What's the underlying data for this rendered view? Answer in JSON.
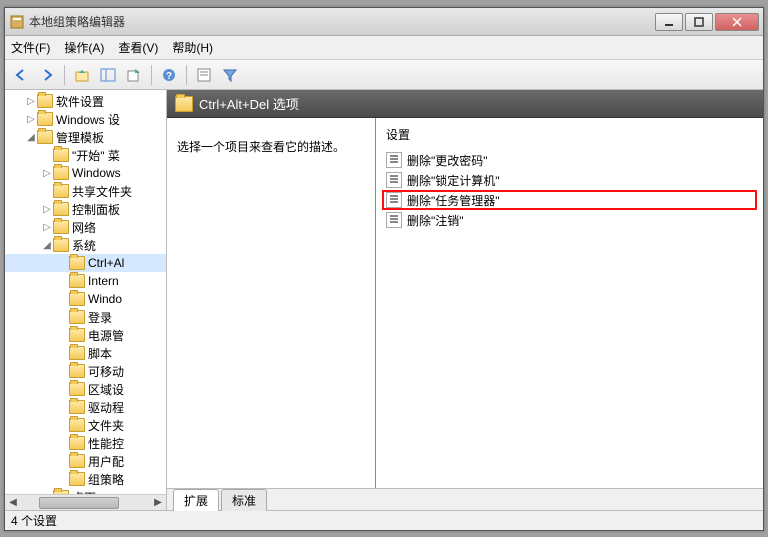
{
  "window": {
    "title": "本地组策略编辑器"
  },
  "menu": {
    "file": "文件(F)",
    "action": "操作(A)",
    "view": "查看(V)",
    "help": "帮助(H)"
  },
  "tree": {
    "items": [
      {
        "label": "软件设置",
        "depth": 1,
        "expander": "▷"
      },
      {
        "label": "Windows 设",
        "depth": 1,
        "expander": "▷"
      },
      {
        "label": "管理模板",
        "depth": 1,
        "expander": "◢"
      },
      {
        "label": "\"开始\" 菜",
        "depth": 2,
        "expander": ""
      },
      {
        "label": "Windows",
        "depth": 2,
        "expander": "▷"
      },
      {
        "label": "共享文件夹",
        "depth": 2,
        "expander": ""
      },
      {
        "label": "控制面板",
        "depth": 2,
        "expander": "▷"
      },
      {
        "label": "网络",
        "depth": 2,
        "expander": "▷"
      },
      {
        "label": "系统",
        "depth": 2,
        "expander": "◢"
      },
      {
        "label": "Ctrl+Al",
        "depth": 3,
        "expander": "",
        "selected": true
      },
      {
        "label": "Intern",
        "depth": 3,
        "expander": ""
      },
      {
        "label": "Windo",
        "depth": 3,
        "expander": ""
      },
      {
        "label": "登录",
        "depth": 3,
        "expander": ""
      },
      {
        "label": "电源管",
        "depth": 3,
        "expander": ""
      },
      {
        "label": "脚本",
        "depth": 3,
        "expander": ""
      },
      {
        "label": "可移动",
        "depth": 3,
        "expander": ""
      },
      {
        "label": "区域设",
        "depth": 3,
        "expander": ""
      },
      {
        "label": "驱动程",
        "depth": 3,
        "expander": ""
      },
      {
        "label": "文件夹",
        "depth": 3,
        "expander": ""
      },
      {
        "label": "性能控",
        "depth": 3,
        "expander": ""
      },
      {
        "label": "用户配",
        "depth": 3,
        "expander": ""
      },
      {
        "label": "组策略",
        "depth": 3,
        "expander": ""
      },
      {
        "label": "桌面",
        "depth": 2,
        "expander": "▷"
      }
    ]
  },
  "content": {
    "header": "Ctrl+Alt+Del 选项",
    "desc": "选择一个项目来查看它的描述。",
    "list_header": "设置",
    "items": [
      {
        "label": "删除\"更改密码\""
      },
      {
        "label": "删除\"锁定计算机\""
      },
      {
        "label": "删除\"任务管理器\"",
        "highlighted": true
      },
      {
        "label": "删除\"注销\""
      }
    ],
    "tabs": {
      "extended": "扩展",
      "standard": "标准"
    }
  },
  "status": "4 个设置"
}
